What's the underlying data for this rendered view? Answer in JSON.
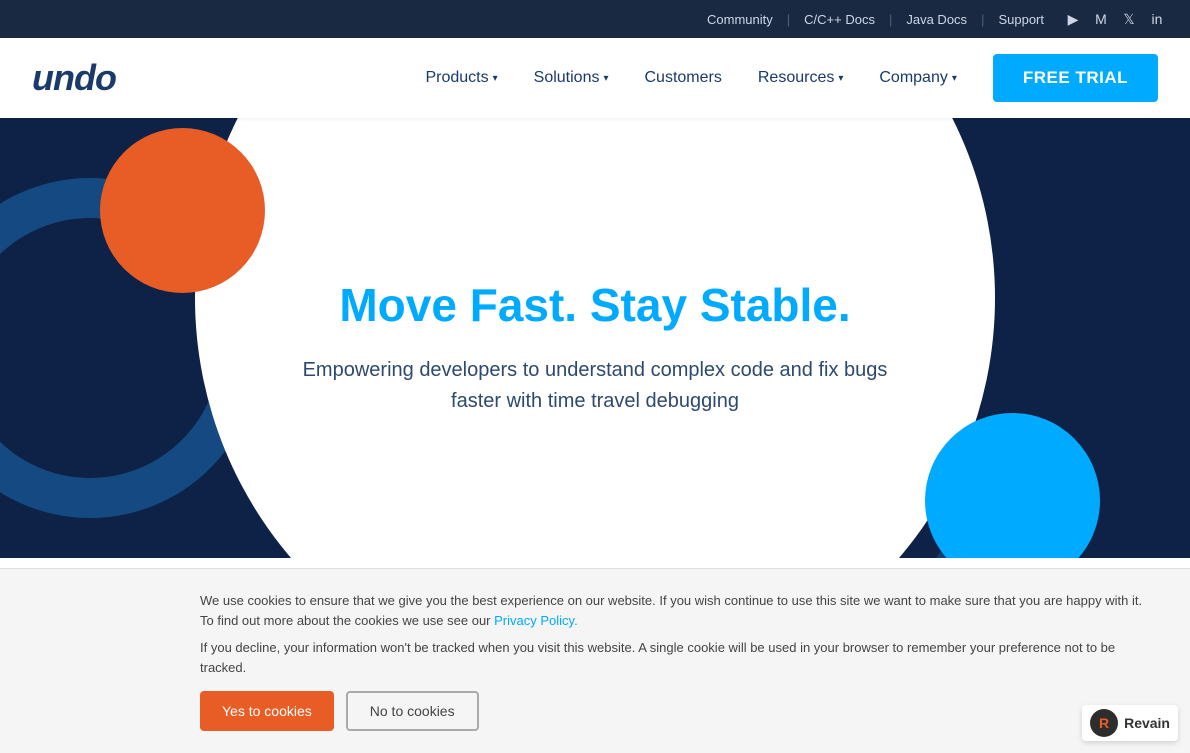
{
  "topbar": {
    "links": [
      {
        "label": "Community",
        "id": "community"
      },
      {
        "label": "C/C++ Docs",
        "id": "cpp-docs"
      },
      {
        "label": "Java Docs",
        "id": "java-docs"
      },
      {
        "label": "Support",
        "id": "support"
      }
    ],
    "icons": [
      {
        "name": "youtube-icon",
        "symbol": "▶"
      },
      {
        "name": "medium-icon",
        "symbol": "M"
      },
      {
        "name": "twitter-icon",
        "symbol": "𝕏"
      },
      {
        "name": "linkedin-icon",
        "symbol": "in"
      }
    ]
  },
  "navbar": {
    "logo": "undo",
    "nav_items": [
      {
        "label": "Products",
        "has_dropdown": true
      },
      {
        "label": "Solutions",
        "has_dropdown": true
      },
      {
        "label": "Customers",
        "has_dropdown": false
      },
      {
        "label": "Resources",
        "has_dropdown": true
      },
      {
        "label": "Company",
        "has_dropdown": true
      }
    ],
    "cta_label": "FREE TRIAL"
  },
  "hero": {
    "title": "Move Fast. Stay Stable.",
    "subtitle": "Empowering developers to understand complex code and fix bugs faster with time travel debugging"
  },
  "cookie": {
    "text1": "We use cookies to ensure that we give you the best experience on our website. If you wish continue to use this site we want to make sure that you are happy with it. To find out more about the cookies we use see our",
    "link_label": "Privacy Policy.",
    "text2": "If you decline, your information won't be tracked when you visit this website. A single cookie will be used in your browser to remember your preference not to be tracked.",
    "yes_label": "Yes to cookies",
    "no_label": "No to cookies"
  },
  "revain": {
    "label": "Revain"
  }
}
